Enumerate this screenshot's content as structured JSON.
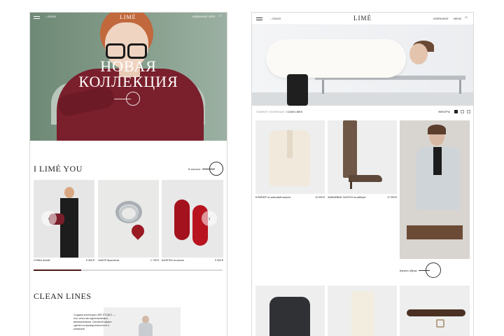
{
  "colors": {
    "accent": "#4a1a14",
    "hero_bg": "#7d9583",
    "product_bg": "#eeeeee"
  },
  "left": {
    "header": {
      "search_label": "ПОИСК",
      "favorites_label": "ИЗБРАННОЕ",
      "cart_label": "КОРЗ",
      "logo": "LIMÉ"
    },
    "hero": {
      "title_line1": "НОВАЯ",
      "title_line2": "КОЛЛЕКЦИЯ"
    },
    "section1": {
      "title": "I LIMÉ YOU",
      "more_label": "В каталог"
    },
    "products": [
      {
        "name": "СУМКА Amelie",
        "price": "5 999 ₽"
      },
      {
        "name": "НАБОР браслетов",
        "price": "1 799 ₽"
      },
      {
        "name": "БАЛЕТКИ из шелка",
        "price": "5 999 ₽"
      }
    ],
    "carousel_progress": 0.25,
    "section2": {
      "title": "CLEAN LINES",
      "text": "Создана коллекция LIMÉ STUDIO — этот сезон мы вдохновляемся минимализмом. Основной акцент сделан на функциональности и комфорте."
    }
  },
  "right": {
    "header": {
      "search_label": "ПОИСК",
      "logo": "LIMÉ",
      "favorites_label": "ИЗБРАННОЕ",
      "menu_label": "МЕНЮ"
    },
    "breadcrumbs": [
      "ГЛАВНАЯ",
      "КОЛЛЕКЦИИ",
      "CLEAN LINES"
    ],
    "filters_label": "ФИЛЬТРЫ",
    "products": [
      {
        "name": "БЛЕЙЗЕР из смесовой шерсти",
        "price": "10 999 ₽"
      },
      {
        "name": "ЗАМШЕВЫЕ САПОГИ на каблуке",
        "price": "17 999 ₽"
      }
    ],
    "buy_look_label": "Купить образ"
  }
}
